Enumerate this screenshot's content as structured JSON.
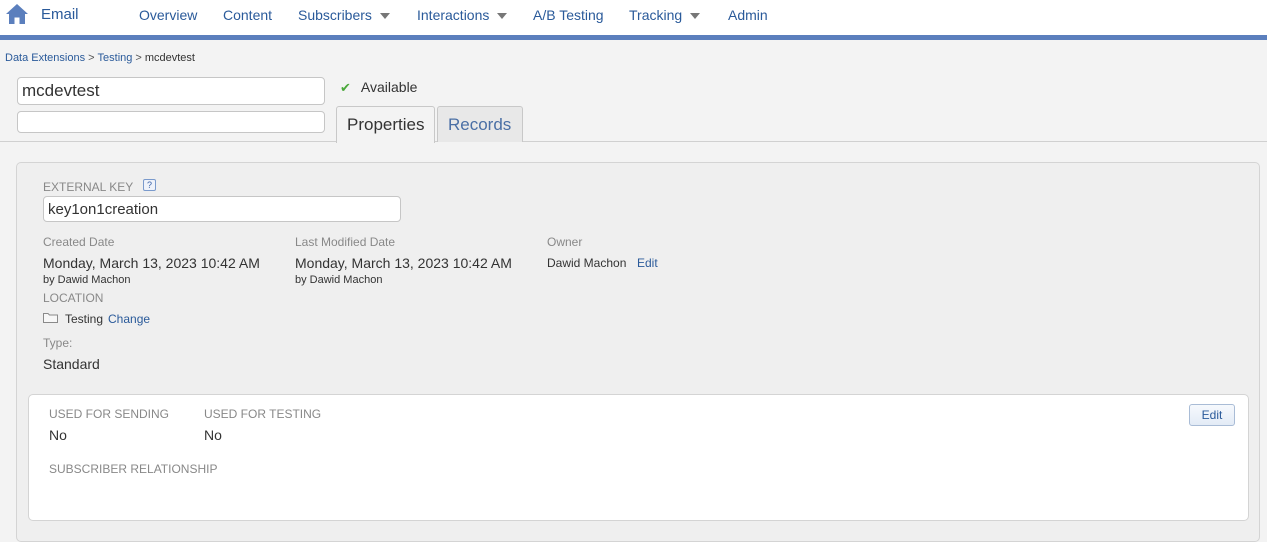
{
  "app": {
    "title": "Email"
  },
  "nav": {
    "items": [
      {
        "label": "Overview"
      },
      {
        "label": "Content"
      },
      {
        "label": "Subscribers"
      },
      {
        "label": "Interactions"
      },
      {
        "label": "A/B Testing"
      },
      {
        "label": "Tracking"
      },
      {
        "label": "Admin"
      }
    ]
  },
  "breadcrumb": {
    "items": [
      "Data Extensions",
      "Testing",
      "mcdevtest"
    ],
    "separator": ">"
  },
  "header": {
    "name_value": "mcdevtest",
    "description_value": "",
    "status": "Available"
  },
  "tabs": [
    {
      "label": "Properties",
      "active": true
    },
    {
      "label": "Records",
      "active": false
    }
  ],
  "properties": {
    "external_key_label": "EXTERNAL KEY",
    "help_icon_text": "?",
    "external_key_value": "key1on1creation",
    "created_label": "Created Date",
    "created_value": "Monday, March 13, 2023 10:42 AM",
    "created_by": "by Dawid Machon",
    "modified_label": "Last Modified Date",
    "modified_value": "Monday, March 13, 2023 10:42 AM",
    "modified_by": "by Dawid Machon",
    "owner_label": "Owner",
    "owner_value": "Dawid Machon",
    "owner_edit": "Edit",
    "location_label": "LOCATION",
    "location_value": "Testing",
    "location_change": "Change",
    "type_label": "Type:",
    "type_value": "Standard"
  },
  "sending": {
    "used_for_sending_label": "USED FOR SENDING",
    "used_for_sending_value": "No",
    "used_for_testing_label": "USED FOR TESTING",
    "used_for_testing_value": "No",
    "subscriber_relationship_label": "SUBSCRIBER RELATIONSHIP",
    "edit_label": "Edit"
  },
  "colors": {
    "accent": "#5b7fbd",
    "link": "#2a5a9a",
    "success": "#4aa83a"
  },
  "icons": {
    "home": "home-icon",
    "help": "help-icon",
    "folder": "folder-icon",
    "check": "check-icon",
    "dropdown": "chevron-down-icon"
  }
}
